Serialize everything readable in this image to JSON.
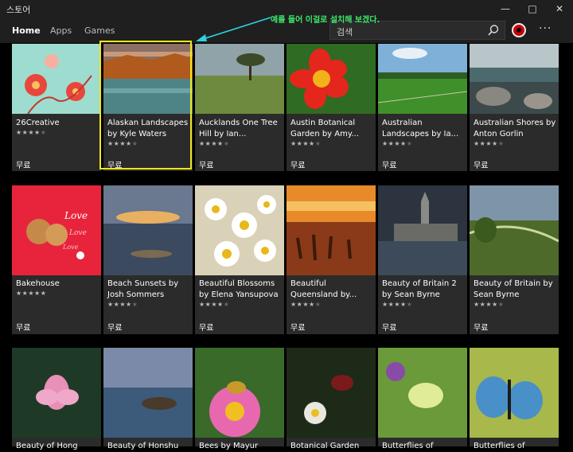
{
  "app_title": "스토어",
  "tabs": [
    {
      "label": "Home"
    },
    {
      "label": "Apps"
    },
    {
      "label": "Games"
    }
  ],
  "search": {
    "placeholder": "검색"
  },
  "annotation": "예를 들어 이걸로 설치해 보겠다.",
  "colors": {
    "accent_highlight": "#f1e51c",
    "annotation": "#3ee86a",
    "tile_bg": "#2b2b2b"
  },
  "tiles": [
    {
      "name": "26Creative",
      "price": "무료",
      "rating": 4.5
    },
    {
      "name": "Alaskan Landscapes by Kyle Waters",
      "price": "무료",
      "rating": 4
    },
    {
      "name": "Aucklands One Tree Hill by Ian...",
      "price": "무료",
      "rating": 4
    },
    {
      "name": "Austin Botanical Garden by Amy...",
      "price": "무료",
      "rating": 4
    },
    {
      "name": "Australian Landscapes by Ia...",
      "price": "무료",
      "rating": 4
    },
    {
      "name": "Australian Shores by Anton Gorlin",
      "price": "무료",
      "rating": 4
    },
    {
      "name": "Bakehouse",
      "price": "무료",
      "rating": 5
    },
    {
      "name": "Beach Sunsets by Josh Sommers",
      "price": "무료",
      "rating": 4
    },
    {
      "name": "Beautiful Blossoms by Elena Yansupova",
      "price": "무료",
      "rating": 4
    },
    {
      "name": "Beautiful Queensland by...",
      "price": "무료",
      "rating": 4
    },
    {
      "name": "Beauty of Britain 2 by Sean Byrne",
      "price": "무료",
      "rating": 4
    },
    {
      "name": "Beauty of Britain by Sean Byrne",
      "price": "무료",
      "rating": 4.5
    },
    {
      "name": "Beauty of Hong",
      "price": "",
      "rating": 0
    },
    {
      "name": "Beauty of Honshu",
      "price": "",
      "rating": 0
    },
    {
      "name": "Bees by Mayur",
      "price": "",
      "rating": 0
    },
    {
      "name": "Botanical Garden",
      "price": "",
      "rating": 0
    },
    {
      "name": "Butterflies of",
      "price": "",
      "rating": 0
    },
    {
      "name": "Butterflies of",
      "price": "",
      "rating": 0
    }
  ]
}
